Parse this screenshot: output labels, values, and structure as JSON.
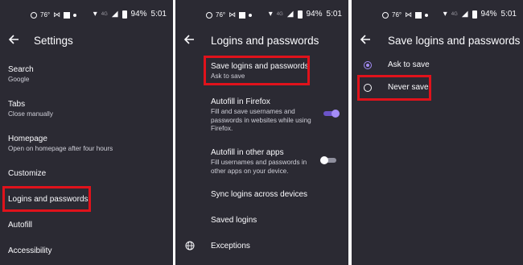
{
  "status": {
    "temp": "76°",
    "signal": "4G",
    "battery": "94%",
    "time": "5:01"
  },
  "colors": {
    "accent": "#a48cf7",
    "highlight": "#e0121b",
    "background": "#2b2a33"
  },
  "screen1": {
    "title": "Settings",
    "items": [
      {
        "label": "Search",
        "sub": "Google"
      },
      {
        "label": "Tabs",
        "sub": "Close manually"
      },
      {
        "label": "Homepage",
        "sub": "Open on homepage after four hours"
      },
      {
        "label": "Customize"
      },
      {
        "label": "Logins and passwords",
        "highlighted": true
      },
      {
        "label": "Autofill"
      },
      {
        "label": "Accessibility"
      }
    ]
  },
  "screen2": {
    "title": "Logins and passwords",
    "items": [
      {
        "label": "Save logins and passwords",
        "sub": "Ask to save",
        "highlighted": true
      },
      {
        "label": "Autofill in Firefox",
        "sub": "Fill and save usernames and passwords in websites while using Firefox.",
        "toggle": true
      },
      {
        "label": "Autofill in other apps",
        "sub": "Fill usernames and passwords in other apps on your device.",
        "toggle": false
      },
      {
        "label": "Sync logins across devices"
      },
      {
        "label": "Saved logins"
      },
      {
        "label": "Exceptions",
        "icon": "globe-icon"
      }
    ]
  },
  "screen3": {
    "title": "Save logins and passwords",
    "options": [
      {
        "label": "Ask to save",
        "selected": true
      },
      {
        "label": "Never save",
        "selected": false,
        "highlighted": true
      }
    ]
  }
}
